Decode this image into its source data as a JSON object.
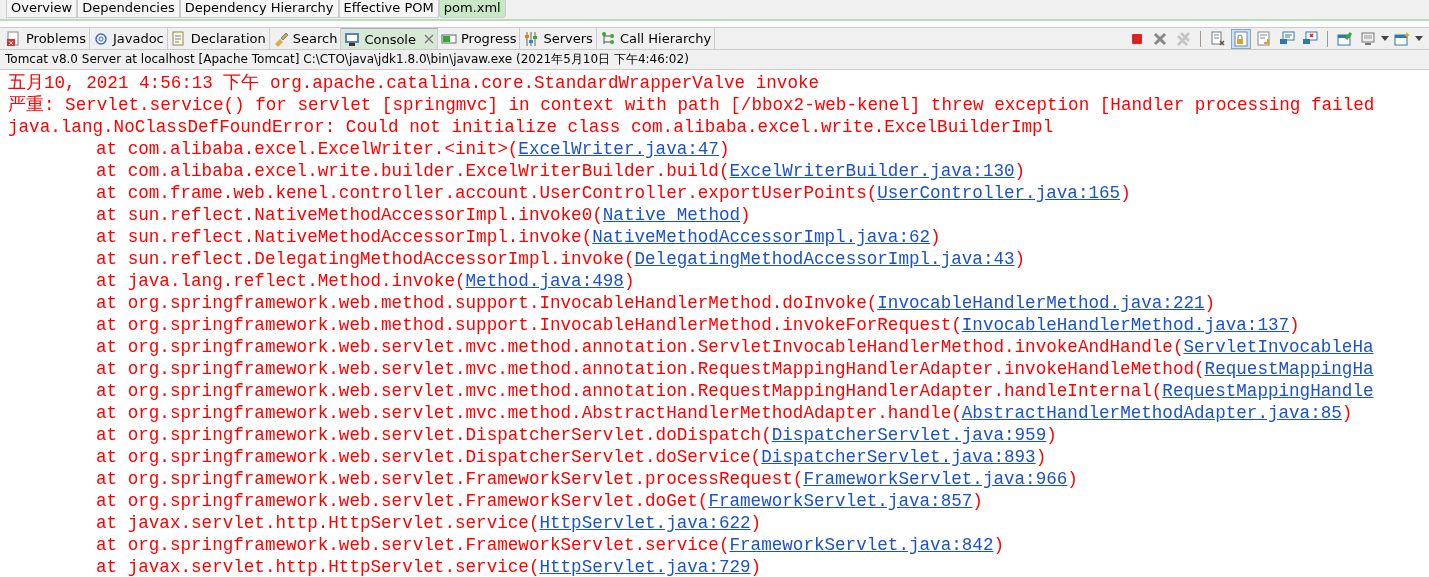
{
  "editor_tabs": [
    {
      "label": "Overview",
      "selected": false
    },
    {
      "label": "Dependencies",
      "selected": false
    },
    {
      "label": "Dependency Hierarchy",
      "selected": false
    },
    {
      "label": "Effective POM",
      "selected": false
    },
    {
      "label": "pom.xml",
      "selected": true
    }
  ],
  "view_tabs": [
    {
      "kind": "problems",
      "label": "Problems",
      "selected": false
    },
    {
      "kind": "javadoc",
      "label": "Javadoc",
      "selected": false
    },
    {
      "kind": "declaration",
      "label": "Declaration",
      "selected": false
    },
    {
      "kind": "search",
      "label": "Search",
      "selected": false
    },
    {
      "kind": "console",
      "label": "Console",
      "selected": true
    },
    {
      "kind": "progress",
      "label": "Progress",
      "selected": false
    },
    {
      "kind": "servers",
      "label": "Servers",
      "selected": false
    },
    {
      "kind": "hierarchy",
      "label": "Call Hierarchy",
      "selected": false
    }
  ],
  "toolbar": [
    {
      "kind": "stop",
      "disabled": false
    },
    {
      "kind": "remove",
      "disabled": false
    },
    {
      "kind": "remove-all",
      "disabled": true
    },
    {
      "kind": "separator"
    },
    {
      "kind": "clear"
    },
    {
      "kind": "scroll-lock",
      "on": true
    },
    {
      "kind": "word-wrap",
      "on": false
    },
    {
      "kind": "show-out"
    },
    {
      "kind": "show-err"
    },
    {
      "kind": "separator"
    },
    {
      "kind": "pin"
    },
    {
      "kind": "display",
      "menu": true
    },
    {
      "kind": "new-console",
      "menu": true
    }
  ],
  "console": {
    "title": "Tomcat v8.0 Server at localhost [Apache Tomcat] C:\\CTO\\java\\jdk1.8.0\\bin\\javaw.exe (2021年5月10日 下午4:46:02)",
    "lines": [
      {
        "kind": "plain",
        "text": "五月10, 2021 4:56:13 下午 org.apache.catalina.core.StandardWrapperValve invoke"
      },
      {
        "kind": "plain",
        "text": "严重: Servlet.service() for servlet [springmvc] in context with path [/bbox2-web-kenel] threw exception [Handler processing failed"
      },
      {
        "kind": "plain",
        "text": "java.lang.NoClassDefFoundError: Could not initialize class com.alibaba.excel.write.ExcelBuilderImpl"
      },
      {
        "kind": "frame",
        "text": "at com.alibaba.excel.ExcelWriter.<init>(",
        "link": "ExcelWriter.java:47",
        "tail": ")"
      },
      {
        "kind": "frame",
        "text": "at com.alibaba.excel.write.builder.ExcelWriterBuilder.build(",
        "link": "ExcelWriterBuilder.java:130",
        "tail": ")"
      },
      {
        "kind": "frame",
        "text": "at com.frame.web.kenel.controller.account.UserController.exportUserPoints(",
        "link": "UserController.java:165",
        "tail": ")"
      },
      {
        "kind": "frame",
        "text": "at sun.reflect.NativeMethodAccessorImpl.invoke0(",
        "link": "Native Method",
        "tail": ")"
      },
      {
        "kind": "frame",
        "text": "at sun.reflect.NativeMethodAccessorImpl.invoke(",
        "link": "NativeMethodAccessorImpl.java:62",
        "tail": ")"
      },
      {
        "kind": "frame",
        "text": "at sun.reflect.DelegatingMethodAccessorImpl.invoke(",
        "link": "DelegatingMethodAccessorImpl.java:43",
        "tail": ")"
      },
      {
        "kind": "frame",
        "text": "at java.lang.reflect.Method.invoke(",
        "link": "Method.java:498",
        "tail": ")"
      },
      {
        "kind": "frame",
        "text": "at org.springframework.web.method.support.InvocableHandlerMethod.doInvoke(",
        "link": "InvocableHandlerMethod.java:221",
        "tail": ")"
      },
      {
        "kind": "frame",
        "text": "at org.springframework.web.method.support.InvocableHandlerMethod.invokeForRequest(",
        "link": "InvocableHandlerMethod.java:137",
        "tail": ")"
      },
      {
        "kind": "frame",
        "text": "at org.springframework.web.servlet.mvc.method.annotation.ServletInvocableHandlerMethod.invokeAndHandle(",
        "link": "ServletInvocableHa"
      },
      {
        "kind": "frame",
        "text": "at org.springframework.web.servlet.mvc.method.annotation.RequestMappingHandlerAdapter.invokeHandleMethod(",
        "link": "RequestMappingHa"
      },
      {
        "kind": "frame",
        "text": "at org.springframework.web.servlet.mvc.method.annotation.RequestMappingHandlerAdapter.handleInternal(",
        "link": "RequestMappingHandle"
      },
      {
        "kind": "frame",
        "text": "at org.springframework.web.servlet.mvc.method.AbstractHandlerMethodAdapter.handle(",
        "link": "AbstractHandlerMethodAdapter.java:85",
        "tail": ")"
      },
      {
        "kind": "frame",
        "text": "at org.springframework.web.servlet.DispatcherServlet.doDispatch(",
        "link": "DispatcherServlet.java:959",
        "tail": ")"
      },
      {
        "kind": "frame",
        "text": "at org.springframework.web.servlet.DispatcherServlet.doService(",
        "link": "DispatcherServlet.java:893",
        "tail": ")"
      },
      {
        "kind": "frame",
        "text": "at org.springframework.web.servlet.FrameworkServlet.processRequest(",
        "link": "FrameworkServlet.java:966",
        "tail": ")"
      },
      {
        "kind": "frame",
        "text": "at org.springframework.web.servlet.FrameworkServlet.doGet(",
        "link": "FrameworkServlet.java:857",
        "tail": ")"
      },
      {
        "kind": "frame",
        "text": "at javax.servlet.http.HttpServlet.service(",
        "link": "HttpServlet.java:622",
        "tail": ")"
      },
      {
        "kind": "frame",
        "text": "at org.springframework.web.servlet.FrameworkServlet.service(",
        "link": "FrameworkServlet.java:842",
        "tail": ")"
      },
      {
        "kind": "frame",
        "text": "at javax.servlet.http.HttpServlet.service(",
        "link": "HttpServlet.java:729",
        "tail": ")"
      }
    ]
  }
}
